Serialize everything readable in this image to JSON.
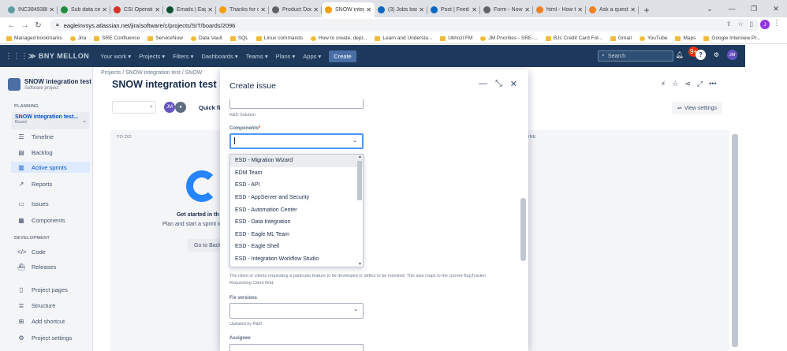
{
  "browser": {
    "tabs": [
      {
        "title": "INC3849388",
        "color": "#5f9ea0",
        "active": false
      },
      {
        "title": "Sub data cen",
        "color": "#1e8e3e",
        "active": false
      },
      {
        "title": "CSI Operatio",
        "color": "#d93025",
        "active": false
      },
      {
        "title": "Emails | Eagl",
        "color": "#0f5132",
        "active": false
      },
      {
        "title": "Thanks for c",
        "color": "#f59e0b",
        "active": false
      },
      {
        "title": "Product Doc",
        "color": "#5f6368",
        "active": false
      },
      {
        "title": "SNOW integ",
        "color": "#f59e0b",
        "active": true
      },
      {
        "title": "(3) Jobs base",
        "color": "#0a66c2",
        "active": false
      },
      {
        "title": "Post | Feed |",
        "color": "#0a66c2",
        "active": false
      },
      {
        "title": "Form - Now",
        "color": "#5f6368",
        "active": false
      },
      {
        "title": "html - How t",
        "color": "#f48024",
        "active": false
      },
      {
        "title": "Ask a questi",
        "color": "#f48024",
        "active": false
      }
    ],
    "new_tab": "+",
    "url": "eagleinvsys.atlassian.net/jira/software/c/projects/SIT/boards/2096",
    "profile_initial": "J",
    "bookmarks": [
      "Managed bookmarks",
      "Jira",
      "SRE Confluence",
      "ServiceNow",
      "Data Vault",
      "SQL",
      "Linux commands",
      "How to create, depl...",
      "Learn and Understa...",
      "Ukhozi FM",
      "JM Priorities - SRE-...",
      "BJs Credit Card Fol...",
      "Gmail",
      "YouTube",
      "Maps",
      "Google Interview Pr..."
    ]
  },
  "jira": {
    "logo": "BNY MELLON",
    "nav": [
      "Your work ▾",
      "Projects ▾",
      "Filters ▾",
      "Dashboards ▾",
      "Teams ▾",
      "Plans ▾",
      "Apps ▾"
    ],
    "create_label": "Create",
    "search_placeholder": "Search",
    "notif_count": "9+",
    "user_initials": "JM"
  },
  "sidebar": {
    "project_name": "SNOW integration test",
    "project_type": "Software project",
    "planning_label": "PLANNING",
    "board_name": "SNOW integration test...",
    "board_type": "Board",
    "items": [
      "Timeline",
      "Backlog",
      "Active sprints",
      "Reports",
      "Issues",
      "Components"
    ],
    "development_label": "DEVELOPMENT",
    "dev_items": [
      "Code",
      "Releases"
    ],
    "bottom_items": [
      "Project pages",
      "Structure",
      "Add shortcut",
      "Project settings"
    ]
  },
  "board": {
    "breadcrumb": "Projects  /  SNOW integration test  /  SNOW",
    "title": "SNOW integration test Scr",
    "quick_filters": "Quick filt",
    "avatar_initials": "JM",
    "view_settings": "View settings",
    "col_todo": "TO DO",
    "col_done": "ONE",
    "empty_title": "Get started in th",
    "empty_sub": "Plan and start a sprint to",
    "goto_btn": "Go to Back"
  },
  "modal": {
    "title": "Create issue",
    "rnd_solution_help": "R&D Solution",
    "components_label": "Components",
    "required_mark": "*",
    "dropdown_options": [
      "ESD - Migration Wizard",
      "EDM Team",
      "ESD - API",
      "ESD - AppServer and Security",
      "ESD - Automation Center",
      "ESD - Data Integration",
      "ESD - Eagle ML Team",
      "ESD - Eagle Shell",
      "ESD - Integration Workflow Studio"
    ],
    "client_help_1": "The client or clients requesting a particular feature to be developed or defect to be resolved.  This also maps to the current BugTracker",
    "client_help_2": "Requesting Client field.",
    "fix_versions_label": "Fix versions",
    "fix_versions_help": "Updated by R&D",
    "assignee_label": "Assignee"
  }
}
